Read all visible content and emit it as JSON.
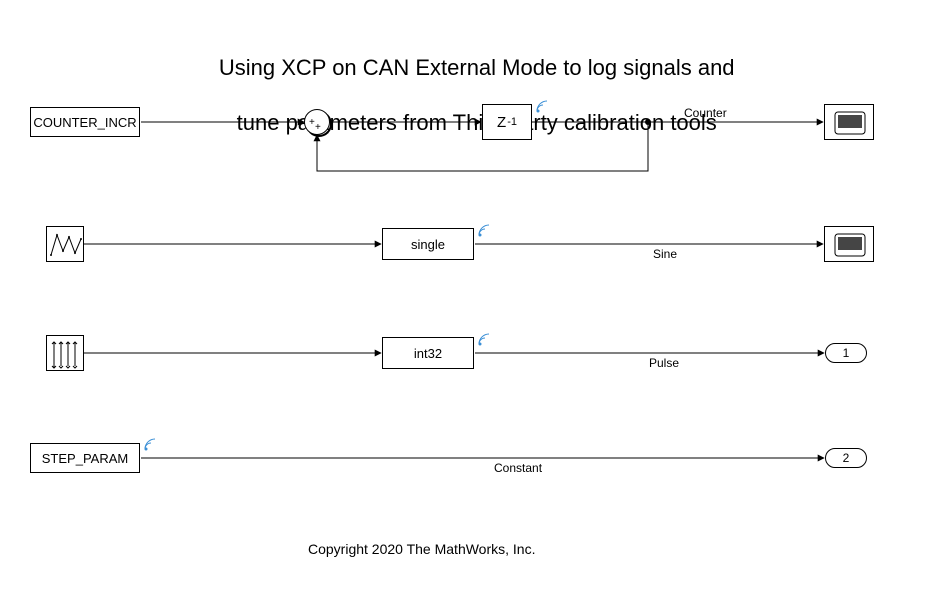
{
  "title": {
    "line1": "Using XCP on CAN External Mode to log signals and",
    "line2": "tune parameters from Third party calibration tools"
  },
  "rows": [
    {
      "source": {
        "kind": "constant-block",
        "label": "COUNTER_INCR"
      },
      "middle": [
        {
          "kind": "sum-block"
        },
        {
          "kind": "unit-delay-block",
          "label_prefix": "Z",
          "label_sup": "-1"
        }
      ],
      "signal_label": "Counter",
      "sink": {
        "kind": "scope-block"
      }
    },
    {
      "source": {
        "kind": "repeating-sequence-block"
      },
      "middle": [
        {
          "kind": "dtconv-block",
          "label": "single"
        }
      ],
      "signal_label": "Sine",
      "sink": {
        "kind": "scope-block"
      }
    },
    {
      "source": {
        "kind": "pulse-block"
      },
      "middle": [
        {
          "kind": "dtconv-block",
          "label": "int32"
        }
      ],
      "signal_label": "Pulse",
      "sink": {
        "kind": "outport",
        "label": "1"
      }
    },
    {
      "source": {
        "kind": "constant-block",
        "label": "STEP_PARAM"
      },
      "middle": [],
      "signal_label": "Constant",
      "sink": {
        "kind": "outport",
        "label": "2"
      }
    }
  ],
  "copyright": "Copyright 2020 The MathWorks, Inc.",
  "chart_data": {
    "type": "diagram",
    "tool": "Simulink block diagram",
    "blocks": [
      {
        "name": "COUNTER_INCR",
        "type": "Constant",
        "row": 1
      },
      {
        "name": "Sum",
        "type": "Sum",
        "row": 1,
        "inputs": "++"
      },
      {
        "name": "Unit Delay",
        "type": "UnitDelay",
        "row": 1,
        "label": "Z^-1"
      },
      {
        "name": "Scope (Counter)",
        "type": "Scope",
        "row": 1
      },
      {
        "name": "Repeating Sequence",
        "type": "RepeatingSequence",
        "row": 2
      },
      {
        "name": "DTConv single",
        "type": "DataTypeConversion",
        "row": 2,
        "dtype": "single"
      },
      {
        "name": "Scope (Sine)",
        "type": "Scope",
        "row": 2
      },
      {
        "name": "Pulse Generator",
        "type": "PulseGenerator",
        "row": 3
      },
      {
        "name": "DTConv int32",
        "type": "DataTypeConversion",
        "row": 3,
        "dtype": "int32"
      },
      {
        "name": "Out1",
        "type": "Outport",
        "row": 3,
        "index": 1
      },
      {
        "name": "STEP_PARAM",
        "type": "Constant",
        "row": 4
      },
      {
        "name": "Out2",
        "type": "Outport",
        "row": 4,
        "index": 2
      }
    ],
    "signals": [
      {
        "name": "Counter",
        "from": "Unit Delay",
        "to": "Scope (Counter)",
        "logged": true
      },
      {
        "name": "feedback",
        "from": "Unit Delay",
        "to": "Sum"
      },
      {
        "name": "Sine",
        "from": "DTConv single",
        "to": "Scope (Sine)",
        "logged": true
      },
      {
        "name": "Pulse",
        "from": "DTConv int32",
        "to": "Out1",
        "logged": true
      },
      {
        "name": "Constant",
        "from": "STEP_PARAM",
        "to": "Out2",
        "logged": true
      }
    ]
  }
}
